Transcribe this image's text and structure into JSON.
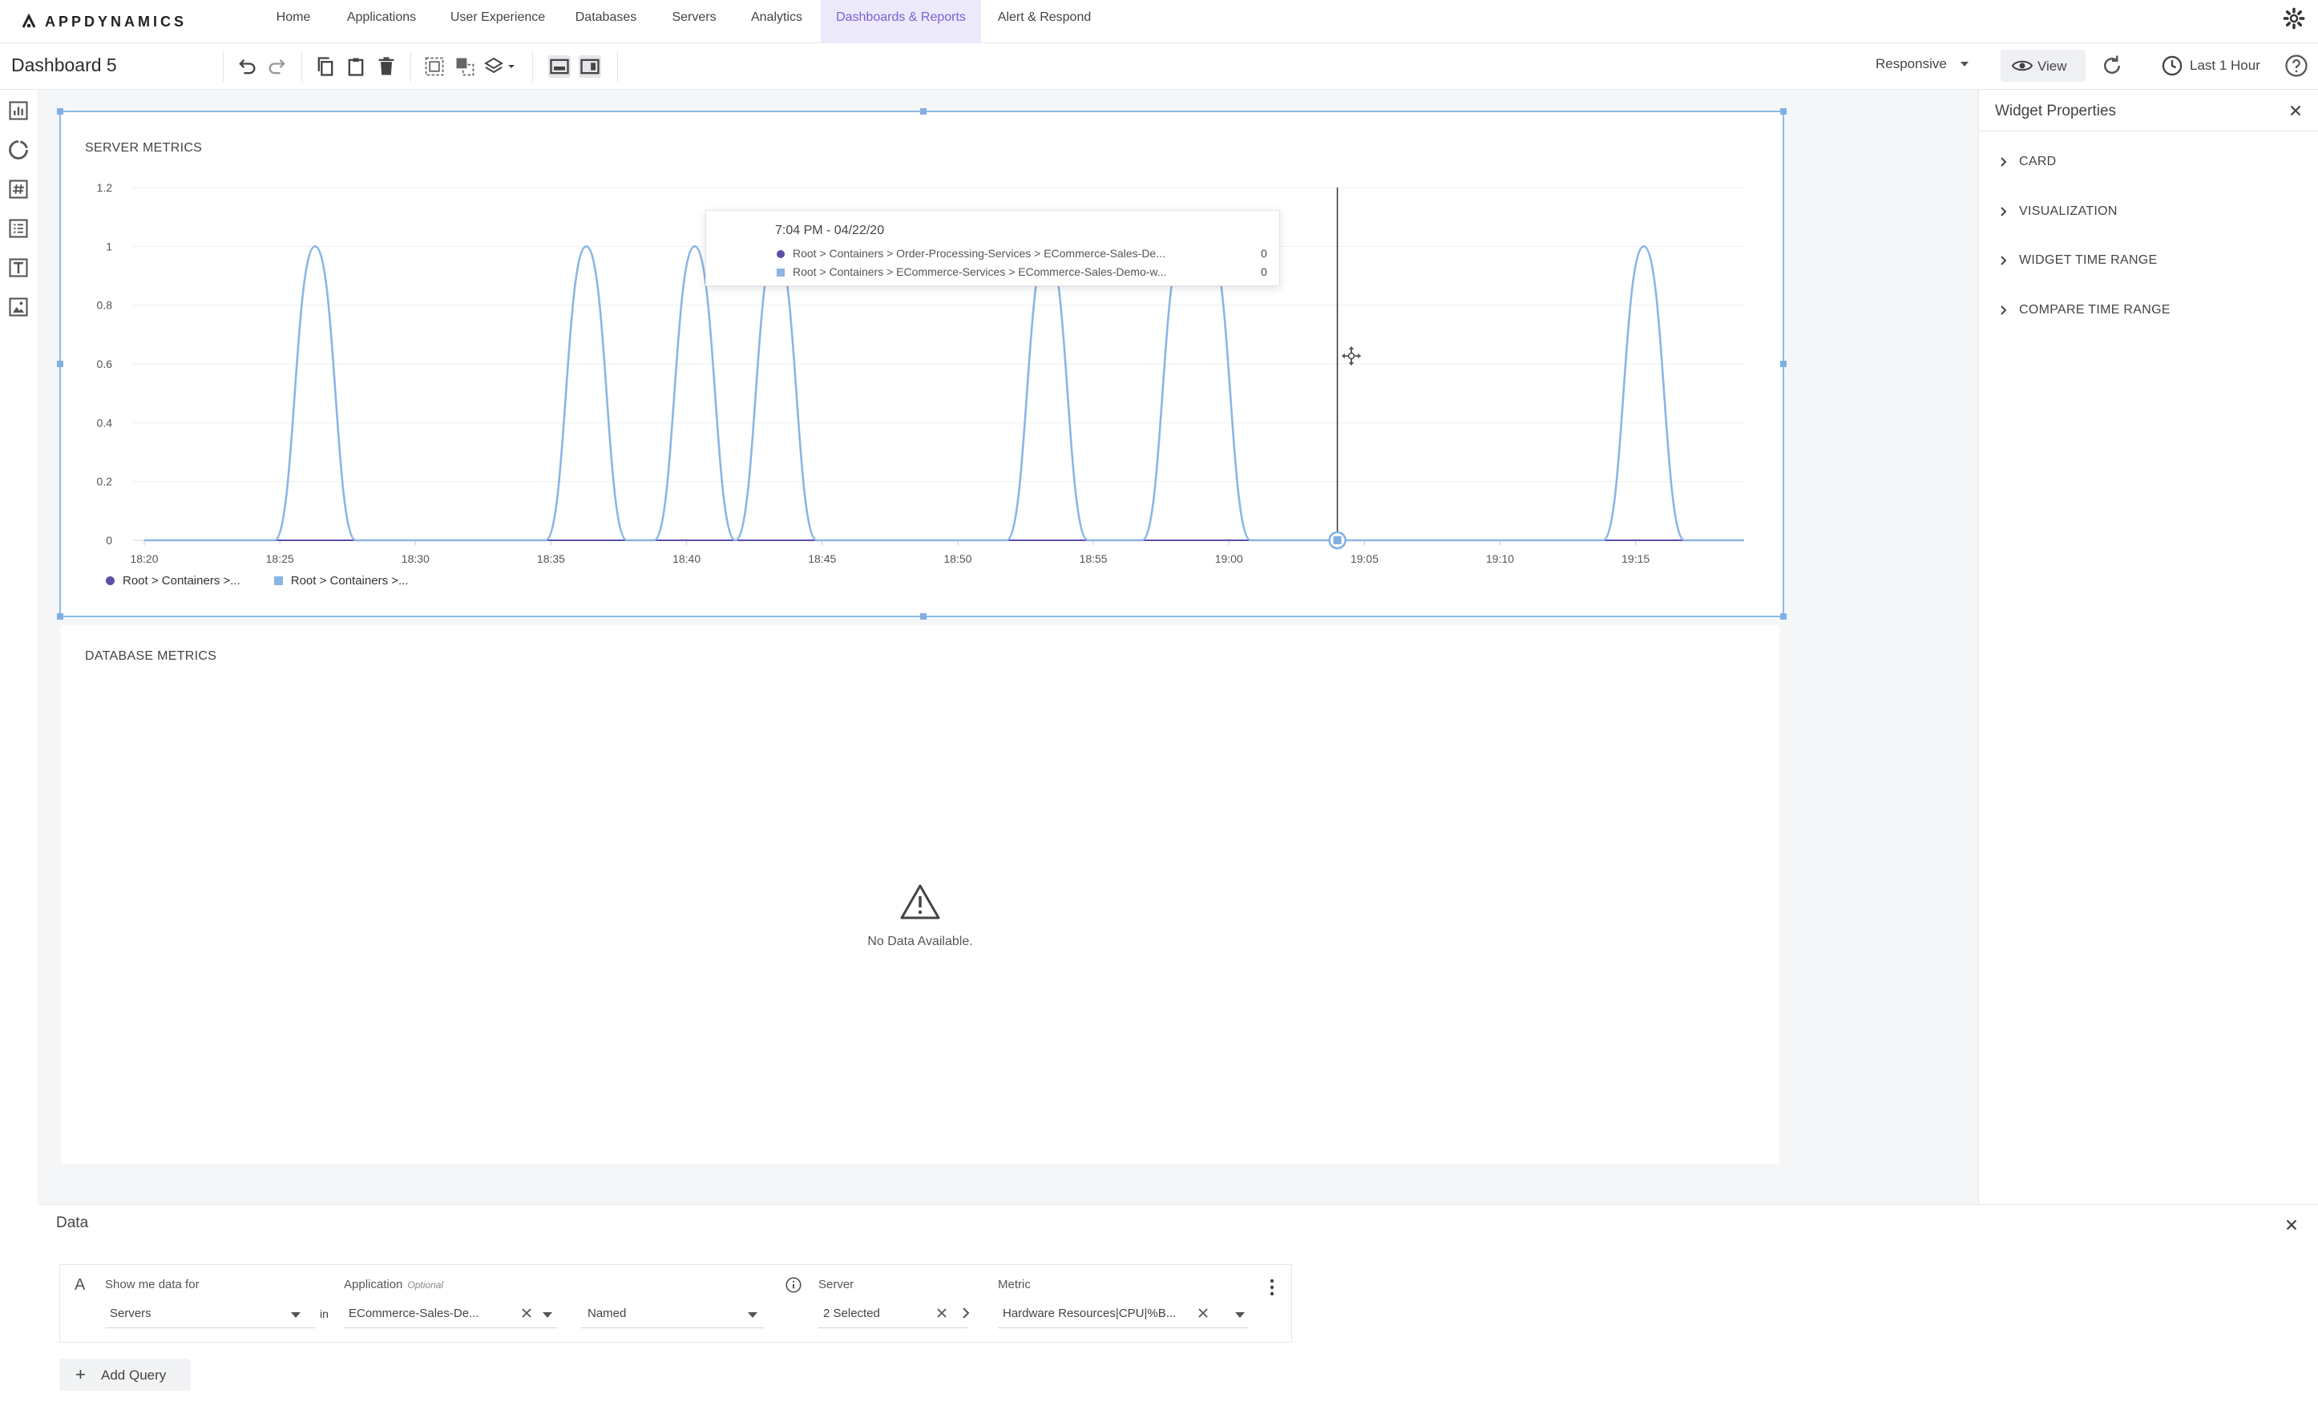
{
  "app": {
    "logo_text": "APPDYNAMICS",
    "accent": "#7b5fd4",
    "nav": [
      {
        "label": "Home",
        "active": false
      },
      {
        "label": "Applications",
        "active": false
      },
      {
        "label": "User Experience",
        "active": false
      },
      {
        "label": "Databases",
        "active": false
      },
      {
        "label": "Servers",
        "active": false
      },
      {
        "label": "Analytics",
        "active": false
      },
      {
        "label": "Dashboards & Reports",
        "active": true
      },
      {
        "label": "Alert & Respond",
        "active": false
      }
    ]
  },
  "toolbar": {
    "title": "Dashboard 5",
    "icons": [
      "undo-icon",
      "redo-icon",
      "copy-icon",
      "paste-icon",
      "delete-icon",
      "group-icon",
      "ungroup-icon",
      "layers-icon",
      "full-width-layout-icon",
      "side-panel-layout-icon"
    ],
    "layout_mode": "Responsive",
    "view_label": "View",
    "time_range": "Last 1 Hour"
  },
  "left_rail": {
    "icons": [
      "chart-widget-icon",
      "pie-widget-icon",
      "metric-number-icon",
      "list-widget-icon",
      "text-widget-icon",
      "image-widget-icon"
    ]
  },
  "server_widget": {
    "title": "SERVER METRICS",
    "legend": [
      {
        "label": "Root > Containers >...",
        "color": "#5b4fa8",
        "shape": "dot"
      },
      {
        "label": "Root > Containers >...",
        "color": "#8bb6e3",
        "shape": "square"
      }
    ],
    "tooltip": {
      "time": "7:04 PM - 04/22/20",
      "rows": [
        {
          "text": "Root > Containers > Order-Processing-Services > ECommerce-Sales-De...",
          "value": "0",
          "color": "#5b4fa8"
        },
        {
          "text": "Root > Containers > ECommerce-Services > ECommerce-Sales-Demo-w...",
          "value": "0",
          "color": "#8bb6e3"
        }
      ]
    }
  },
  "chart_data": {
    "type": "line",
    "title": "SERVER METRICS",
    "xlabel": "",
    "ylabel": "",
    "x_ticks": [
      "18:20",
      "18:25",
      "18:30",
      "18:35",
      "18:40",
      "18:45",
      "18:50",
      "18:55",
      "19:00",
      "19:05",
      "19:10",
      "19:15"
    ],
    "y_ticks": [
      "0",
      "0.2",
      "0.4",
      "0.6",
      "0.8",
      "1",
      "1.2"
    ],
    "ylim": [
      0,
      1.2
    ],
    "xlim_minutes": [
      1100,
      1159
    ],
    "grid": true,
    "legend_position": "bottom-left",
    "cursor_time": "19:04",
    "series": [
      {
        "color": "#5b4fa8",
        "points": [
          [
            1100,
            0
          ],
          [
            1159,
            0
          ]
        ]
      },
      {
        "color": "#8bb6e3",
        "points": [
          [
            1100,
            0
          ],
          [
            1104.8,
            0
          ],
          [
            1106.3,
            1
          ],
          [
            1107.8,
            0
          ],
          [
            1114.8,
            0
          ],
          [
            1116.3,
            1
          ],
          [
            1117.8,
            0
          ],
          [
            1118.8,
            0
          ],
          [
            1120.3,
            1
          ],
          [
            1121.8,
            0
          ],
          [
            1121.8,
            0
          ],
          [
            1123.3,
            1
          ],
          [
            1124.8,
            0
          ],
          [
            1131.8,
            0
          ],
          [
            1133.3,
            1
          ],
          [
            1134.8,
            0
          ],
          [
            1136.8,
            0
          ],
          [
            1138.3,
            1
          ],
          [
            1139.3,
            1
          ],
          [
            1140.8,
            0
          ],
          [
            1153.8,
            0
          ],
          [
            1155.3,
            1
          ],
          [
            1156.8,
            0
          ],
          [
            1159,
            0
          ]
        ]
      }
    ]
  },
  "db_widget": {
    "title": "DATABASE METRICS",
    "empty_message": "No Data Available."
  },
  "properties": {
    "title": "Widget Properties",
    "sections": [
      "CARD",
      "VISUALIZATION",
      "WIDGET TIME RANGE",
      "COMPARE TIME RANGE"
    ]
  },
  "data_panel": {
    "title": "Data",
    "query": {
      "letter": "A",
      "show_me_label": "Show me data for",
      "show_me_value": "Servers",
      "in_label": "in",
      "application_label": "Application",
      "application_optional": "Optional",
      "application_value": "ECommerce-Sales-De...",
      "match_value": "Named",
      "server_label": "Server",
      "server_value": "2 Selected",
      "metric_label": "Metric",
      "metric_value": "Hardware Resources|CPU|%B..."
    },
    "add_query_label": "Add Query"
  }
}
